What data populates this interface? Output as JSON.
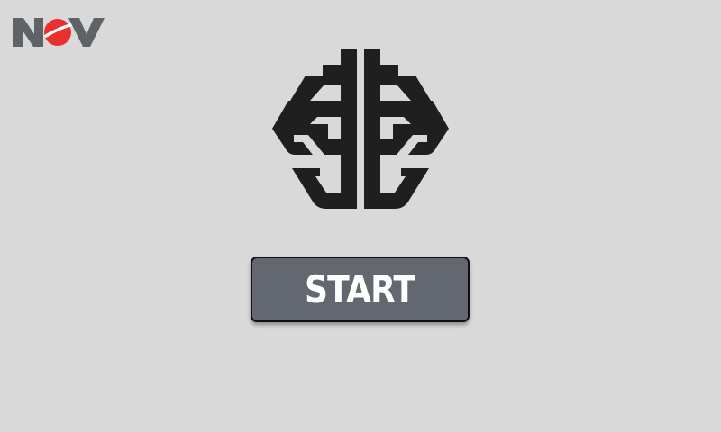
{
  "branding": {
    "logo_text": "NOV",
    "logo_icon": "nov-logo",
    "logo_text_color": "#5f6368",
    "logo_accent_color": "#e8312f"
  },
  "hero": {
    "icon": "brain-icon",
    "icon_color": "#1f1f1f"
  },
  "actions": {
    "start_label": "START",
    "start_bg_color": "#636770"
  },
  "colors": {
    "background": "#d9d9d9"
  }
}
